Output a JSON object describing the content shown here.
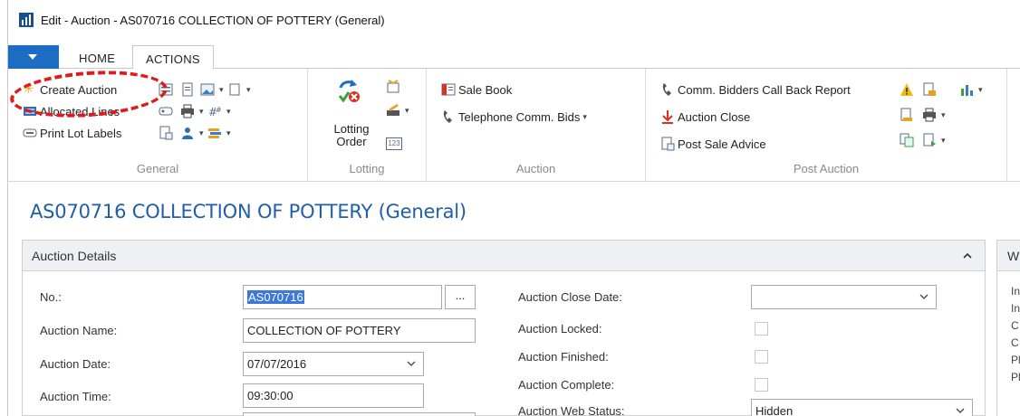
{
  "window": {
    "title": "Edit - Auction - AS070716 COLLECTION OF POTTERY (General)"
  },
  "tabs": {
    "home": "HOME",
    "actions": "ACTIONS"
  },
  "ribbon": {
    "general": {
      "label": "General",
      "create_auction": "Create Auction",
      "allocated_lines": "Allocated Lines",
      "print_lot_labels": "Print Lot Labels"
    },
    "lotting": {
      "label": "Lotting",
      "lotting_order_line1": "Lotting",
      "lotting_order_line2": "Order",
      "counter_icon_text": "123"
    },
    "auction": {
      "label": "Auction",
      "sale_book": "Sale Book",
      "telephone_comm_bids": "Telephone Comm. Bids"
    },
    "post_auction": {
      "label": "Post Auction",
      "comm_bidders_call_back_report": "Comm. Bidders Call Back Report",
      "auction_close": "Auction Close",
      "post_sale_advice": "Post Sale Advice"
    }
  },
  "page": {
    "title": "AS070716 COLLECTION OF POTTERY (General)"
  },
  "details": {
    "header": "Auction Details",
    "no_label": "No.:",
    "no_value": "AS070716",
    "lookup": "...",
    "name_label": "Auction Name:",
    "name_value": "COLLECTION OF POTTERY",
    "date_label": "Auction Date:",
    "date_value": "07/07/2016",
    "time_label": "Auction Time:",
    "time_value": "09:30:00",
    "close_date_label": "Auction Close Date:",
    "close_date_value": "",
    "locked_label": "Auction Locked:",
    "finished_label": "Auction Finished:",
    "complete_label": "Auction Complete:",
    "web_status_label": "Auction Web Status:",
    "web_status_value": "Hidden"
  },
  "side_panel": {
    "header_initial": "W",
    "line_initials": [
      "In",
      "In",
      "C",
      "C",
      "Pl",
      "Pl"
    ]
  },
  "colors": {
    "accent_blue": "#1e6dc4",
    "title_blue": "#1f5ea8",
    "annotation_red": "#e21a1a"
  }
}
